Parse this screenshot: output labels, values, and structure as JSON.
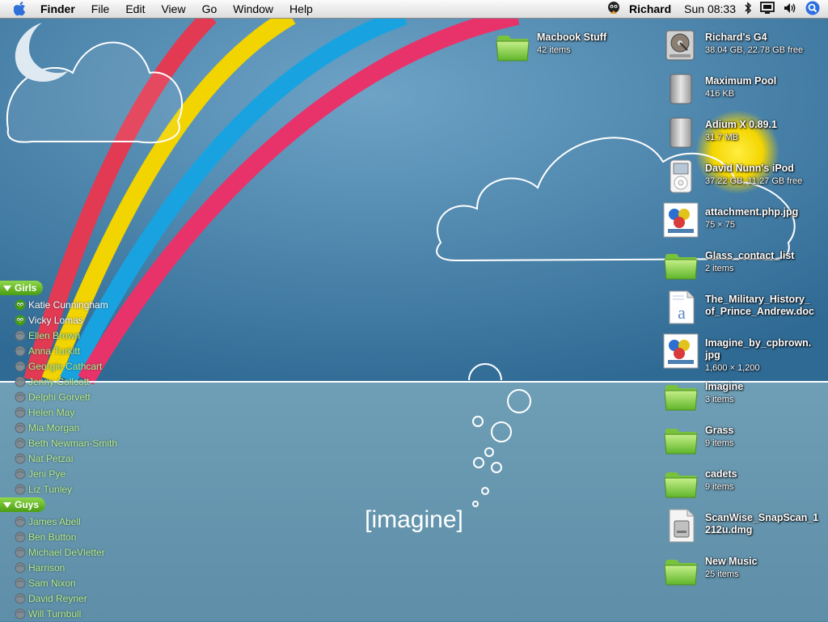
{
  "menubar": {
    "app": "Finder",
    "menus": [
      "File",
      "Edit",
      "View",
      "Go",
      "Window",
      "Help"
    ],
    "user": "Richard",
    "clock": "Sun 08:33"
  },
  "wallpaper": {
    "logo_text": "[imagine]"
  },
  "desktop_icons": [
    {
      "title": "Macbook Stuff",
      "subtitle": "42 items",
      "icon": "folder-icon"
    },
    {
      "title": "Richard's G4",
      "subtitle": "38.04 GB, 22.78 GB free",
      "icon": "hard-drive-icon"
    },
    {
      "title": "Maximum Pool",
      "subtitle": "416 KB",
      "icon": "disk-image-icon"
    },
    {
      "title": "Adium X 0.89.1",
      "subtitle": "31.7 MB",
      "icon": "disk-image-icon"
    },
    {
      "title": "David Nunn's iPod",
      "subtitle": "37.22 GB, 11.27 GB free",
      "icon": "ipod-icon"
    },
    {
      "title": "attachment.php.jpg",
      "subtitle": "75 × 75",
      "icon": "image-thumbnail-icon"
    },
    {
      "title": "Glass_contact_list",
      "subtitle": "2 items",
      "icon": "folder-icon"
    },
    {
      "title": "The_Military_History_\nof_Prince_Andrew.doc",
      "subtitle": "",
      "icon": "document-icon"
    },
    {
      "title": "Imagine_by_cpbrown.\njpg",
      "subtitle": "1,600 × 1,200",
      "icon": "image-thumbnail-icon"
    },
    {
      "title": "Imagine",
      "subtitle": "3 items",
      "icon": "folder-icon"
    },
    {
      "title": "Grass",
      "subtitle": "9 items",
      "icon": "folder-icon"
    },
    {
      "title": "cadets",
      "subtitle": "9 items",
      "icon": "folder-icon"
    },
    {
      "title": "ScanWise_SnapScan_1\n212u.dmg",
      "subtitle": "",
      "icon": "dmg-file-icon"
    },
    {
      "title": "New Music",
      "subtitle": "25 items",
      "icon": "folder-icon"
    }
  ],
  "buddy_list": {
    "groups": [
      {
        "name": "Girls",
        "buddies": [
          {
            "name": "Katie Cunningham",
            "status": "online"
          },
          {
            "name": "Vicky Lomas",
            "status": "online"
          },
          {
            "name": "Ellen Brown",
            "status": "offline"
          },
          {
            "name": "Anna Turkitt",
            "status": "offline"
          },
          {
            "name": "Georgie Cathcart",
            "status": "offline"
          },
          {
            "name": "Jenny Collcott",
            "status": "offline"
          },
          {
            "name": "Delphi Gorvett",
            "status": "offline"
          },
          {
            "name": "Helen May",
            "status": "offline"
          },
          {
            "name": "Mia Morgan",
            "status": "offline"
          },
          {
            "name": "Beth Newman-Smith",
            "status": "offline"
          },
          {
            "name": "Nat Petzal",
            "status": "offline"
          },
          {
            "name": "Jeni Pye",
            "status": "offline"
          },
          {
            "name": "Liz Tunley",
            "status": "offline"
          }
        ]
      },
      {
        "name": "Guys",
        "buddies": [
          {
            "name": "James Abell",
            "status": "offline"
          },
          {
            "name": "Ben Button",
            "status": "offline"
          },
          {
            "name": "Michael DeVletter",
            "status": "offline"
          },
          {
            "name": "Harrison",
            "status": "offline"
          },
          {
            "name": "Sam Nixon",
            "status": "offline"
          },
          {
            "name": "David Reyner",
            "status": "offline"
          },
          {
            "name": "Will Turnbull",
            "status": "offline"
          }
        ]
      }
    ]
  },
  "colors": {
    "sky": "#3f7aa3",
    "water": "#6899b0",
    "rainbow": [
      "#e23a52",
      "#f4d800",
      "#17a2e0",
      "#e8336a"
    ],
    "online_text": "#ffffff",
    "offline_text": "#b8f08a"
  }
}
